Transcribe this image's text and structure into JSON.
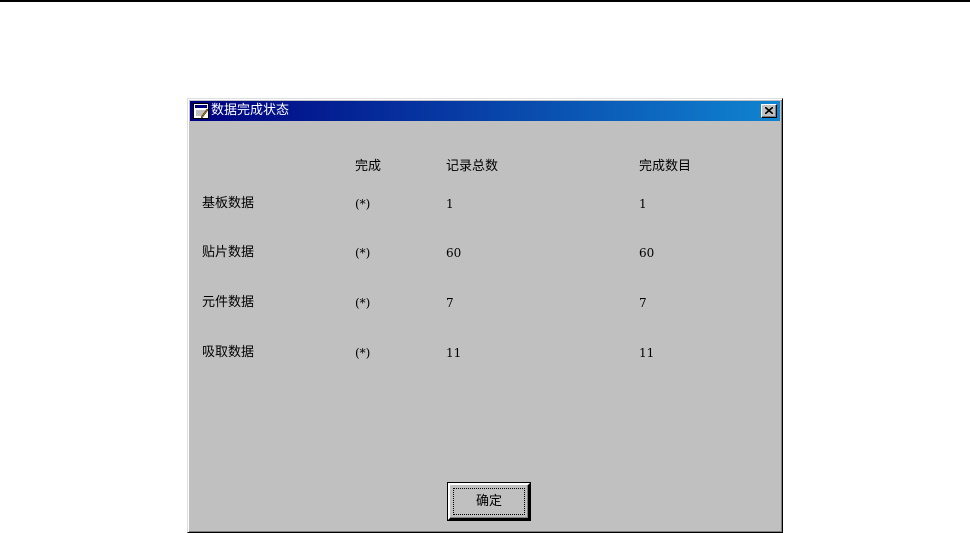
{
  "dialog": {
    "title": "数据完成状态",
    "icon": "app-window-icon",
    "close_icon": "close-icon"
  },
  "columns": {
    "done": "完成",
    "total": "记录总数",
    "count": "完成数目"
  },
  "rows": [
    {
      "name": "基板数据",
      "done": "(*)",
      "total": "1",
      "count": "1"
    },
    {
      "name": "贴片数据",
      "done": "(*)",
      "total": "60",
      "count": "60"
    },
    {
      "name": "元件数据",
      "done": "(*)",
      "total": "7",
      "count": "7"
    },
    {
      "name": "吸取数据",
      "done": "(*)",
      "total": "11",
      "count": "11"
    }
  ],
  "buttons": {
    "ok": "确定"
  },
  "colors": {
    "title_start": "#000080",
    "title_end": "#1084d0",
    "face": "#c0c0c0"
  }
}
